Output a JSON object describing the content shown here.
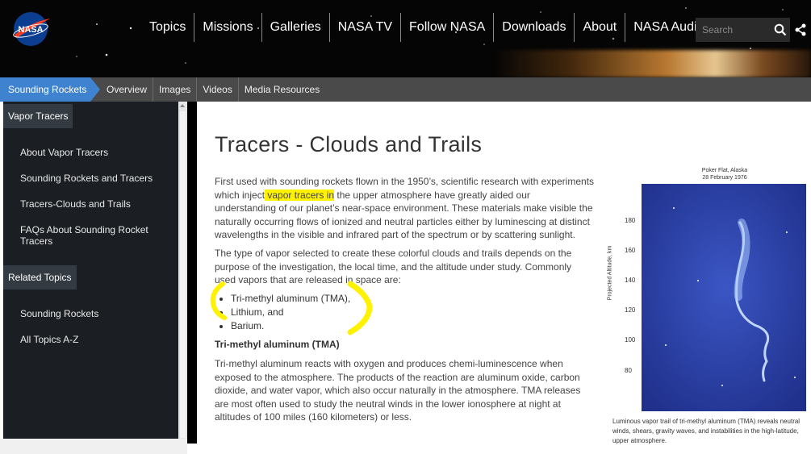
{
  "header": {
    "logo_text": "NASA",
    "nav": [
      "Topics",
      "Missions",
      "Galleries",
      "NASA TV",
      "Follow NASA",
      "Downloads",
      "About",
      "NASA Audiences"
    ],
    "search_placeholder": "Search",
    "icons": [
      "nasa-logo",
      "search-icon",
      "share-icon"
    ]
  },
  "subnav": {
    "current": "Sounding Rockets",
    "items": [
      "Overview",
      "Images",
      "Videos",
      "Media Resources"
    ]
  },
  "sidebar": {
    "section1_title": "Vapor Tracers",
    "section1_links": [
      "About Vapor Tracers",
      "Sounding Rockets and Tracers",
      "Tracers-Clouds and Trails",
      "FAQs About Sounding Rocket Tracers"
    ],
    "section2_title": "Related Topics",
    "section2_links": [
      "Sounding Rockets",
      "All Topics A-Z"
    ]
  },
  "main": {
    "title": "Tracers - Clouds and Trails",
    "p1_before": "First used with sounding rockets flown in the 1950’s, scientific research with experiments which inject",
    "p1_highlight": " vapor tracers in",
    "p1_after": " the upper atmosphere have greatly aided our understanding of our planet’s near-space environment. These materials make visible the naturally occurring flows of ionized and neutral particles either by luminescing at distinct wavelengths in the visible and infrared part of the spectrum or by scattering sunlight.",
    "p2": "The type of vapor selected to create these colorful clouds and trails depends on the purpose of the investigation, the local time, and the altitude under study. Commonly used vapors that are released in space are:",
    "vapors": [
      "Tri-methyl aluminum (TMA),",
      "Lithium, and",
      "Barium."
    ],
    "subheading": "Tri-methyl aluminum (TMA)",
    "p3": "Tri-methyl aluminum reacts with oxygen and produces chemi-luminescence when exposed to the atmosphere. The products of the reaction are aluminum oxide, carbon dioxide, and water vapor, which also occur naturally in the atmosphere. TMA releases are most often used to study the neutral winds in the lower ionosphere at night at altitudes of 100 miles (160 kilometers) or less."
  },
  "figure": {
    "caption_top_line1": "Poker Flat, Alaska",
    "caption_top_line2": "28 February 1976",
    "ylabel": "Projected Altitude, km",
    "ticks": [
      "180",
      "160",
      "140",
      "120",
      "100",
      "80"
    ],
    "caption": "Luminous vapor trail of tri-methyl aluminum (TMA) reveals neutral winds, shears, gravity waves, and instabilities in the high-latitude, upper atmosphere."
  },
  "colors": {
    "accent_blue": "#3f83d0",
    "highlight": "#fff200",
    "sidebar_bg": "#1b1f24"
  }
}
